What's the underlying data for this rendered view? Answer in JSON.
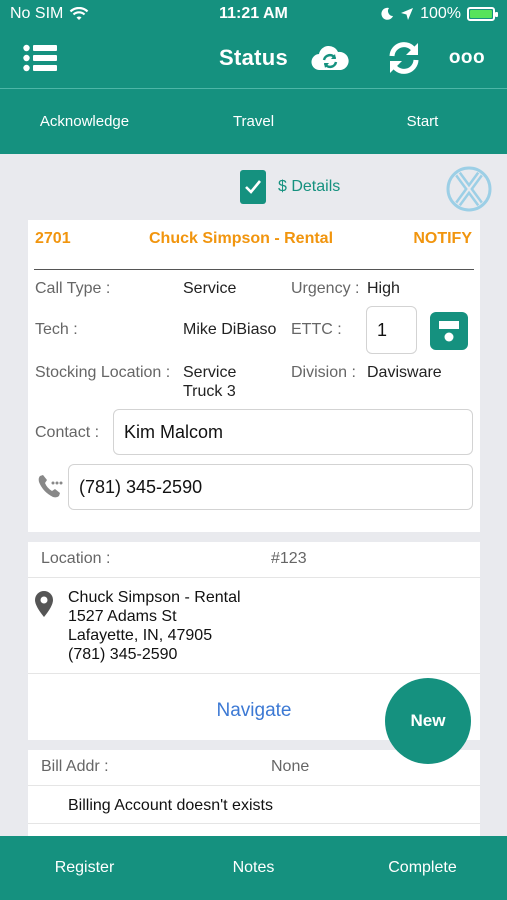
{
  "status_bar": {
    "carrier": "No SIM",
    "time": "11:21 AM",
    "battery": "100%",
    "battery_level": 1.0,
    "icons": [
      "wifi-icon",
      "moon-icon",
      "location-arrow-icon",
      "battery-icon"
    ]
  },
  "header": {
    "title": "Status",
    "more_label": "ooo",
    "icons": [
      "list-menu-icon",
      "cloud-sync-icon",
      "refresh-icon"
    ]
  },
  "actions": [
    "Acknowledge",
    "Travel",
    "Start"
  ],
  "details": {
    "label": "$ Details",
    "checked": true
  },
  "call": {
    "number": "2701",
    "customer": "Chuck Simpson - Rental",
    "notify": "NOTIFY",
    "call_type_label": "Call Type :",
    "call_type": "Service",
    "urgency_label": "Urgency :",
    "urgency": "High",
    "tech_label": "Tech :",
    "tech": "Mike DiBiaso",
    "ettc_label": "ETTC :",
    "ettc": "1",
    "stocking_label": "Stocking Location :",
    "stocking_line1": "Service",
    "stocking_line2": "Truck 3",
    "division_label": "Division :",
    "division": "Davisware",
    "contact_label": "Contact :",
    "contact": "Kim Malcom",
    "phone": "(781) 345-2590"
  },
  "location": {
    "label": "Location :",
    "id": "#123",
    "name": "Chuck Simpson - Rental",
    "street": "1527 Adams St",
    "city": "Lafayette, IN, 47905",
    "phone": "(781) 345-2590",
    "navigate": "Navigate"
  },
  "billing": {
    "label": "Bill Addr :",
    "value": "None",
    "message": "Billing Account doesn't exists"
  },
  "fab_label": "New",
  "bottom_tabs": [
    "Register",
    "Notes",
    "Complete"
  ],
  "colors": {
    "primary": "#15917f",
    "accent_orange": "#f1950e",
    "link_blue": "#3c79d4",
    "background": "#e9eaee"
  }
}
